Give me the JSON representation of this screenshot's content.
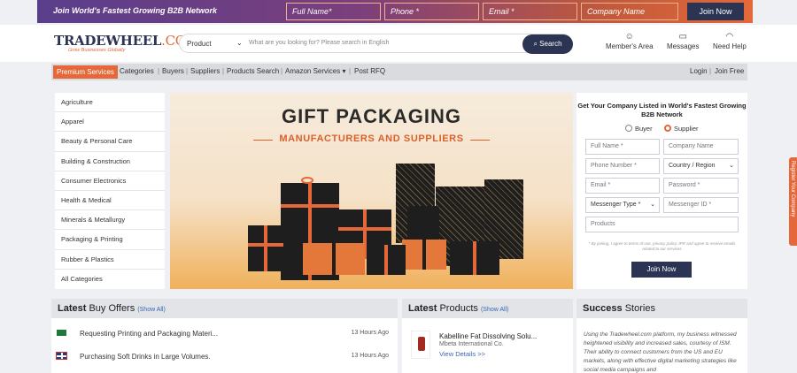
{
  "topbar": {
    "tagline": "Join World's Fastest Growing B2B Network",
    "fields": [
      "Full Name*",
      "Phone *",
      "Email *",
      "Company Name"
    ],
    "join": "Join Now"
  },
  "header": {
    "logo_main": "TRADEWHEEL",
    "logo_com": ".COM",
    "logo_sub": "Grow Businesses Globally",
    "search_category": "Product",
    "search_placeholder": "What are you looking for? Please search in English",
    "search_button": "Search",
    "icons": [
      {
        "label": "Member's Area",
        "icon": "user-icon"
      },
      {
        "label": "Messages",
        "icon": "message-icon"
      },
      {
        "label": "Need Help",
        "icon": "headset-icon"
      }
    ]
  },
  "nav": {
    "premium": "Premium Services",
    "items": [
      "Categories",
      "Buyers",
      "Suppliers",
      "Products Search",
      "Amazon Services ▾",
      "Post RFQ"
    ],
    "login": "Login",
    "join": "Join Free"
  },
  "categories": [
    "Agriculture",
    "Apparel",
    "Beauty & Personal Care",
    "Building & Construction",
    "Consumer Electronics",
    "Health & Medical",
    "Minerals & Metallurgy",
    "Packaging & Printing",
    "Rubber & Plastics",
    "All Categories"
  ],
  "banner": {
    "title": "GIFT PACKAGING",
    "subtitle": "MANUFACTURERS AND SUPPLIERS"
  },
  "register": {
    "title": "Get Your Company Listed in World's Fastest Growing B2B Network",
    "buyer": "Buyer",
    "supplier": "Supplier",
    "fields": {
      "full_name": "Full Name *",
      "company_name": "Company Name",
      "phone": "Phone Number *",
      "country": "Country / Region",
      "email": "Email *",
      "password": "Password *",
      "messenger_type": "Messenger Type *",
      "messenger_id": "Messenger ID *",
      "products": "Products"
    },
    "terms": "* By joining, I agree to terms of use, privacy policy, IPR and agree to receive emails related to our services",
    "join": "Join Now"
  },
  "feedback": "Register Your Company",
  "buy_offers": {
    "title_bold": "Latest",
    "title_rest": " Buy Offers",
    "show_all": "(Show All)",
    "rows": [
      {
        "text": "Requesting Printing and Packaging Materi...",
        "time": "13 Hours Ago",
        "flag": "saudi-arabia-flag"
      },
      {
        "text": "Purchasing Soft Drinks in Large Volumes.",
        "time": "13 Hours Ago",
        "flag": "uk-flag"
      }
    ]
  },
  "latest_products": {
    "title_bold": "Latest",
    "title_rest": " Products",
    "show_all": "(Show All)",
    "product_name": "Kabelline Fat Dissolving Solu...",
    "company": "Mbeta International Co.",
    "link": "View Details >>"
  },
  "success": {
    "title_bold": "Success",
    "title_rest": " Stories",
    "text": "Using the Tradewheel.com platform, my business witnessed heightened visibility and increased sales, courtesy of ISM. Their ability to connect customers from the US and EU markets, along with effective digital marketing strategies like social media campaigns and"
  },
  "colors": {
    "accent": "#e4683a",
    "navy": "#2b3452"
  }
}
